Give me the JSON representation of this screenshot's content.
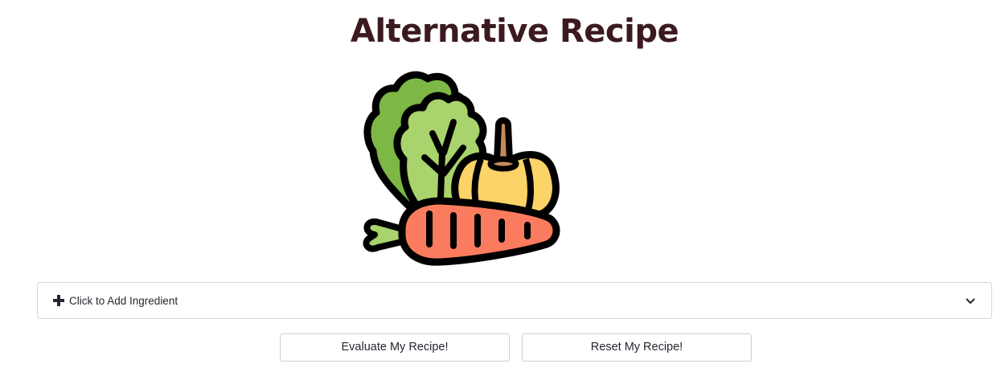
{
  "page": {
    "title": "Alternative Recipe",
    "hero_icon": "vegetables-illustration-icon"
  },
  "ingredient_expander": {
    "label": "Click to Add Ingredient",
    "icon": "plus-icon",
    "toggle_icon": "chevron-down-icon",
    "expanded": false
  },
  "actions": {
    "evaluate_label": "Evaluate My Recipe!",
    "reset_label": "Reset My Recipe!"
  },
  "colors": {
    "title": "#3b1a20",
    "lettuce_dark": "#7db746",
    "lettuce_light": "#a9d36c",
    "pumpkin": "#fbd366",
    "pumpkin_stem": "#c48b5a",
    "carrot": "#fb7b5f",
    "carrot_leaves": "#a9d36c",
    "outline": "#000000"
  }
}
